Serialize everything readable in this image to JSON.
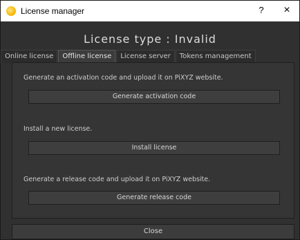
{
  "window": {
    "title": "License manager",
    "help_label": "?",
    "close_label": "×"
  },
  "heading": "License type : Invalid",
  "tabs": [
    {
      "label": "Online license",
      "active": false
    },
    {
      "label": "Offline license",
      "active": true
    },
    {
      "label": "License server",
      "active": false
    },
    {
      "label": "Tokens management",
      "active": false
    }
  ],
  "offline": {
    "activation_desc": "Generate an activation code and upload it on PiXYZ website.",
    "activation_button": "Generate activation code",
    "install_desc": "Install a new license.",
    "install_button": "Install license",
    "release_desc": "Generate a release code and upload it on PiXYZ website.",
    "release_button": "Generate release code"
  },
  "footer": {
    "close_button": "Close"
  },
  "icons": {
    "app": "pixyz-sun-icon"
  },
  "colors": {
    "background": "#303030",
    "accent_icon": "#f5b400"
  }
}
